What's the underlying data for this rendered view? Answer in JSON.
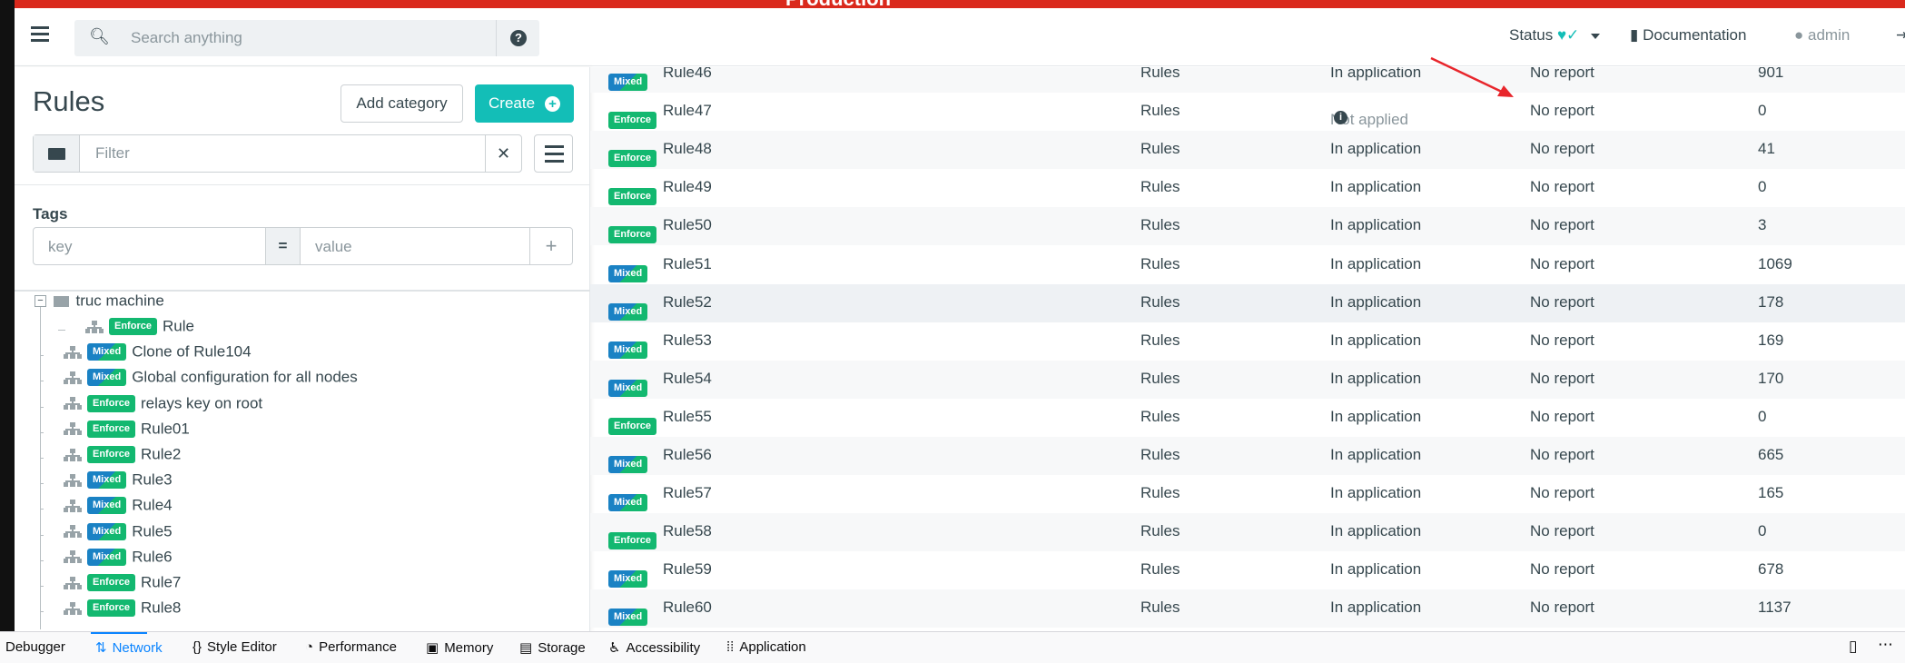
{
  "env_banner": "Production",
  "header": {
    "search_placeholder": "Search anything",
    "help_glyph": "?",
    "status_label": "Status",
    "documentation_label": "Documentation",
    "user_label": "admin"
  },
  "sidebar": {
    "title": "Rules",
    "add_category_label": "Add category",
    "create_label": "Create",
    "filter_placeholder": "Filter",
    "clear_glyph": "✕",
    "tags_label": "Tags",
    "tag_key_placeholder": "key",
    "tag_eq": "=",
    "tag_value_placeholder": "value",
    "tag_add_glyph": "+",
    "tree": {
      "category": "truc machine",
      "items": [
        {
          "badge": "Enforce",
          "label": "Rule"
        },
        {
          "badge": "Mixed",
          "label": "Clone of Rule104"
        },
        {
          "badge": "Mixed",
          "label": "Global configuration for all nodes"
        },
        {
          "badge": "Enforce",
          "label": "relays key on root"
        },
        {
          "badge": "Enforce",
          "label": "Rule01"
        },
        {
          "badge": "Enforce",
          "label": "Rule2"
        },
        {
          "badge": "Mixed",
          "label": "Rule3"
        },
        {
          "badge": "Mixed",
          "label": "Rule4"
        },
        {
          "badge": "Mixed",
          "label": "Rule5"
        },
        {
          "badge": "Mixed",
          "label": "Rule6"
        },
        {
          "badge": "Enforce",
          "label": "Rule7"
        },
        {
          "badge": "Enforce",
          "label": "Rule8"
        }
      ]
    }
  },
  "table": {
    "rows": [
      {
        "badge": "Mixed",
        "name": "Rule46",
        "category": "Rules",
        "status": "In application",
        "compliance": "No report",
        "changes": "901"
      },
      {
        "badge": "Enforce",
        "name": "Rule47",
        "category": "Rules",
        "status": "Not applied",
        "compliance": "No report",
        "changes": "0"
      },
      {
        "badge": "Enforce",
        "name": "Rule48",
        "category": "Rules",
        "status": "In application",
        "compliance": "No report",
        "changes": "41"
      },
      {
        "badge": "Enforce",
        "name": "Rule49",
        "category": "Rules",
        "status": "In application",
        "compliance": "No report",
        "changes": "0"
      },
      {
        "badge": "Enforce",
        "name": "Rule50",
        "category": "Rules",
        "status": "In application",
        "compliance": "No report",
        "changes": "3"
      },
      {
        "badge": "Mixed",
        "name": "Rule51",
        "category": "Rules",
        "status": "In application",
        "compliance": "No report",
        "changes": "1069"
      },
      {
        "badge": "Mixed",
        "name": "Rule52",
        "category": "Rules",
        "status": "In application",
        "compliance": "No report",
        "changes": "178"
      },
      {
        "badge": "Mixed",
        "name": "Rule53",
        "category": "Rules",
        "status": "In application",
        "compliance": "No report",
        "changes": "169"
      },
      {
        "badge": "Mixed",
        "name": "Rule54",
        "category": "Rules",
        "status": "In application",
        "compliance": "No report",
        "changes": "170"
      },
      {
        "badge": "Enforce",
        "name": "Rule55",
        "category": "Rules",
        "status": "In application",
        "compliance": "No report",
        "changes": "0"
      },
      {
        "badge": "Mixed",
        "name": "Rule56",
        "category": "Rules",
        "status": "In application",
        "compliance": "No report",
        "changes": "665"
      },
      {
        "badge": "Mixed",
        "name": "Rule57",
        "category": "Rules",
        "status": "In application",
        "compliance": "No report",
        "changes": "165"
      },
      {
        "badge": "Enforce",
        "name": "Rule58",
        "category": "Rules",
        "status": "In application",
        "compliance": "No report",
        "changes": "0"
      },
      {
        "badge": "Mixed",
        "name": "Rule59",
        "category": "Rules",
        "status": "In application",
        "compliance": "No report",
        "changes": "678"
      },
      {
        "badge": "Mixed",
        "name": "Rule60",
        "category": "Rules",
        "status": "In application",
        "compliance": "No report",
        "changes": "1137"
      }
    ]
  },
  "devtools": {
    "tabs": [
      "Debugger",
      "Network",
      "Style Editor",
      "Performance",
      "Memory",
      "Storage",
      "Accessibility",
      "Application"
    ],
    "active_tab": "Network"
  },
  "colors": {
    "accent": "#13beb7",
    "enforce": "#13b870",
    "mixed": "#1a82c4",
    "banner": "#da291c",
    "arrow": "#e8262c"
  }
}
